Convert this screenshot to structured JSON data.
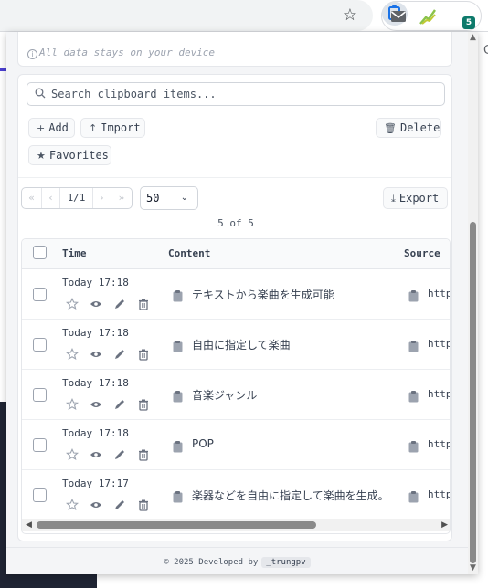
{
  "browser": {
    "bookmark_icon": "star-outline-icon",
    "extensions": [
      {
        "name": "mail-icon"
      },
      {
        "name": "chart-icon"
      },
      {
        "name": "clipboard-icon",
        "badge": "5"
      }
    ],
    "right_clip": "C"
  },
  "privacy": {
    "icon": "info-icon",
    "text": "All data stays on your device"
  },
  "search": {
    "placeholder": "Search clipboard items..."
  },
  "toolbar": {
    "add_icon": "+",
    "add_label": "Add",
    "import_icon": "↥",
    "import_label": "Import",
    "delete_icon": "🗑",
    "delete_label": "Delete",
    "favorites_icon": "★",
    "favorites_label": "Favorites"
  },
  "pagination": {
    "first": "«",
    "prev": "‹",
    "page": "1/1",
    "next": "›",
    "last": "»",
    "per_page": "50",
    "export_icon": "⤓",
    "export_label": "Export",
    "count": "5 of 5"
  },
  "table": {
    "headers": {
      "time": "Time",
      "content": "Content",
      "source": "Source"
    },
    "rows": [
      {
        "time": "Today 17:18",
        "content": "テキストから楽曲を生成可能",
        "source": "http"
      },
      {
        "time": "Today 17:18",
        "content": "自由に指定して楽曲",
        "source": "http"
      },
      {
        "time": "Today 17:18",
        "content": "音楽ジャンル",
        "source": "http"
      },
      {
        "time": "Today 17:18",
        "content": "POP",
        "source": "http"
      },
      {
        "time": "Today 17:17",
        "content": "楽器などを自由に指定して楽曲を生成。",
        "source": "http"
      }
    ]
  },
  "footer": {
    "text": "© 2025  Developed by",
    "author": "_trungpv"
  },
  "colors": {
    "accent_badge": "#0d7a6b",
    "scrollbar": "#8a8a8a",
    "panel_bg": "#f4f5f7"
  }
}
